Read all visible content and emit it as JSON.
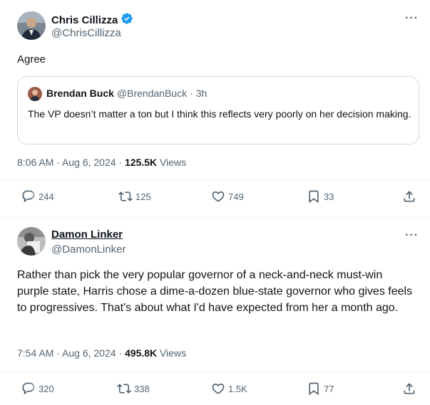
{
  "tweets": [
    {
      "author": {
        "name": "Chris Cillizza",
        "handle": "@ChrisCillizza",
        "verified": true
      },
      "more_label": "···",
      "text": "Agree",
      "quote": {
        "author": "Brendan Buck",
        "handle": "@BrendanBuck",
        "age": "· 3h",
        "text": "The VP doesn’t matter a ton but I think this reflects very poorly on her decision making."
      },
      "timestamp": "8:06 AM · Aug 6, 2024 ·",
      "views_count": "125.5K",
      "views_label": "Views",
      "actions": {
        "replies": "244",
        "reposts": "125",
        "likes": "749",
        "bookmarks": "33"
      }
    },
    {
      "author": {
        "name": "Damon Linker",
        "handle": "@DamonLinker",
        "verified": false
      },
      "more_label": "···",
      "text": "Rather than pick the very popular governor of a neck-and-neck must-win purple state, Harris chose a dime-a-dozen blue-state governor who gives feels to progressives. That's about what I'd have expected from her a month ago.",
      "timestamp": "7:54 AM · Aug 6, 2024 ·",
      "views_count": "495.8K",
      "views_label": "Views",
      "actions": {
        "replies": "320",
        "reposts": "338",
        "likes": "1.5K",
        "bookmarks": "77"
      }
    }
  ],
  "colors": {
    "verified": "#1d9bf0",
    "muted": "#536471",
    "text": "#0f1419",
    "border": "#cfd9de"
  }
}
